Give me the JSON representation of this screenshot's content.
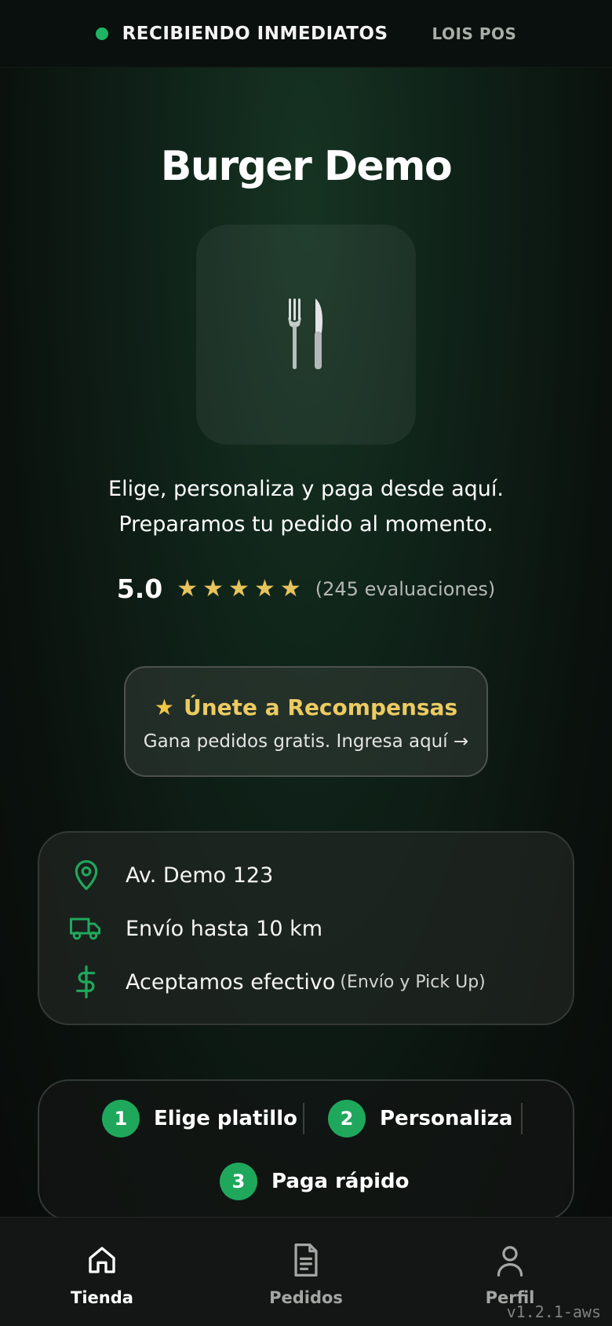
{
  "header": {
    "status_text": "RECIBIENDO INMEDIATOS",
    "status_color": "#1fb463",
    "brand": "LOIS POS"
  },
  "store": {
    "name": "Burger Demo",
    "logo_icon": "fork-and-knife-icon",
    "tagline_line1": "Elige, personaliza y paga desde aquí.",
    "tagline_line2": "Preparamos tu pedido al momento.",
    "rating_value": "5.0",
    "rating_stars": 5,
    "reviews_text": "(245 evaluaciones)"
  },
  "rewards": {
    "title": "Únete a Recompensas",
    "subtitle": "Gana pedidos gratis. Ingresa aquí →",
    "accent_color": "#eccb62"
  },
  "info": {
    "address": "Av. Demo 123",
    "delivery": "Envío hasta 10 km",
    "payment": "Aceptamos efectivo",
    "payment_note": "(Envío y Pick Up)",
    "icon_color": "#1fa85c"
  },
  "steps": [
    {
      "number": "1",
      "label": "Elige platillo"
    },
    {
      "number": "2",
      "label": "Personaliza"
    },
    {
      "number": "3",
      "label": "Paga rápido"
    }
  ],
  "nav": {
    "items": [
      {
        "label": "Tienda",
        "icon": "home-icon",
        "active": true
      },
      {
        "label": "Pedidos",
        "icon": "document-icon",
        "active": false
      },
      {
        "label": "Perfil",
        "icon": "user-icon",
        "active": false
      }
    ],
    "active_color": "#ffffff",
    "inactive_color": "#a3a7a4"
  },
  "version": "v1.2.1-aws"
}
